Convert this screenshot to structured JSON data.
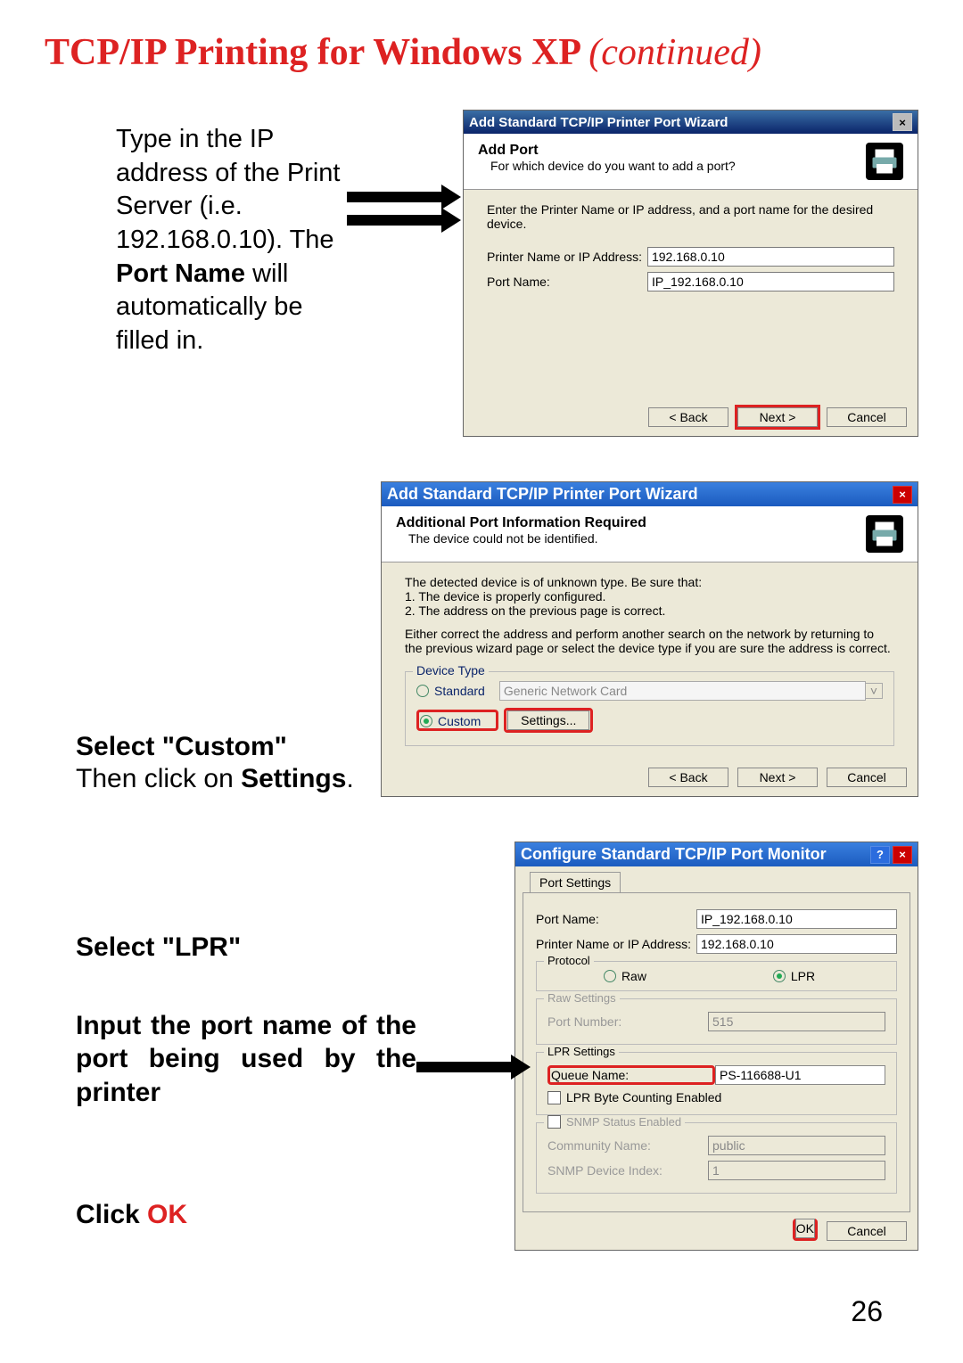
{
  "title_main": "TCP/IP Printing for Windows XP ",
  "title_ital": "(continued)",
  "instr1": {
    "a": "Type in the IP address of the Print Server (i.e. 192.168.0.10). The ",
    "b": "Port Name",
    "c": " will automatically be filled in."
  },
  "instr2": {
    "a": "Select \"Custom\"",
    "b": "Then click on ",
    "c": "Settings",
    "d": "."
  },
  "instr3": {
    "a": "Select \"LPR\"",
    "b": "Input the port name of the port being used by the printer",
    "c": "Click ",
    "d": "OK"
  },
  "dlg1": {
    "title": "Add Standard TCP/IP Printer Port Wizard",
    "head_t": "Add Port",
    "head_s": "For which device do you want to add a port?",
    "desc": "Enter the Printer Name or IP address, and a port name for the desired device.",
    "lab_ip": "Printer Name or IP Address:",
    "lab_port": "Port Name:",
    "val_ip": "192.168.0.10",
    "val_port": "IP_192.168.0.10",
    "back": "< Back",
    "next": "Next >",
    "cancel": "Cancel"
  },
  "dlg2": {
    "title": "Add Standard TCP/IP Printer Port Wizard",
    "head_t": "Additional Port Information Required",
    "head_s": "The device could not be identified.",
    "para1": "The detected device is of unknown type.  Be sure that:",
    "li1": "1. The device is properly configured.",
    "li2": "2.  The address on the previous page is correct.",
    "para2": "Either correct the address and perform another search on the network by returning to the previous wizard page or select the device type if you are sure the address is correct.",
    "grp": "Device Type",
    "r_std": "Standard",
    "sel_std": "Generic Network Card",
    "r_cus": "Custom",
    "btn_set": "Settings...",
    "back": "< Back",
    "next": "Next >",
    "cancel": "Cancel"
  },
  "dlg3": {
    "title": "Configure Standard TCP/IP Port Monitor",
    "tab": "Port Settings",
    "l_pname": "Port Name:",
    "v_pname": "IP_192.168.0.10",
    "l_ip": "Printer Name or IP Address:",
    "v_ip": "192.168.0.10",
    "grp_proto": "Protocol",
    "r_raw": "Raw",
    "r_lpr": "LPR",
    "grp_raw": "Raw Settings",
    "l_rawport": "Port Number:",
    "v_rawport": "515",
    "grp_lpr": "LPR Settings",
    "l_queue": "Queue Name:",
    "v_queue": "PS-116688-U1",
    "chk_lpr": "LPR Byte Counting Enabled",
    "grp_snmp": "SNMP Status Enabled",
    "l_comm": "Community Name:",
    "v_comm": "public",
    "l_idx": "SNMP Device Index:",
    "v_idx": "1",
    "ok": "OK",
    "cancel": "Cancel"
  },
  "page_number": "26"
}
